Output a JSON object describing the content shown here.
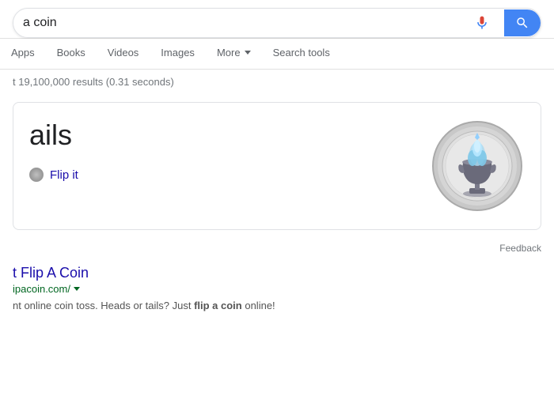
{
  "searchbar": {
    "value": "a coin",
    "placeholder": "Search",
    "mic_label": "Voice search",
    "search_label": "Google Search"
  },
  "nav": {
    "tabs": [
      {
        "id": "apps",
        "label": "Apps",
        "active": false,
        "has_chevron": false
      },
      {
        "id": "books",
        "label": "Books",
        "active": false,
        "has_chevron": false
      },
      {
        "id": "videos",
        "label": "Videos",
        "active": false,
        "has_chevron": false
      },
      {
        "id": "images",
        "label": "Images",
        "active": false,
        "has_chevron": false
      },
      {
        "id": "more",
        "label": "More",
        "active": false,
        "has_chevron": true
      },
      {
        "id": "search-tools",
        "label": "Search tools",
        "active": false,
        "has_chevron": false
      }
    ]
  },
  "results": {
    "count_text": "t 19,100,000 results (0.31 seconds)",
    "coin_flip": {
      "title": "ails",
      "flip_link": "Flip it",
      "feedback_label": "Feedback"
    },
    "organic": [
      {
        "title": "t Flip A Coin",
        "url": "ipacoin.com/",
        "snippet": "nt online coin toss. Heads or tails? Just flip a coin online!"
      }
    ]
  },
  "colors": {
    "accent_blue": "#4285f4",
    "link_blue": "#1a0dab",
    "green_url": "#006621",
    "text_dark": "#202124",
    "text_gray": "#70757a"
  }
}
